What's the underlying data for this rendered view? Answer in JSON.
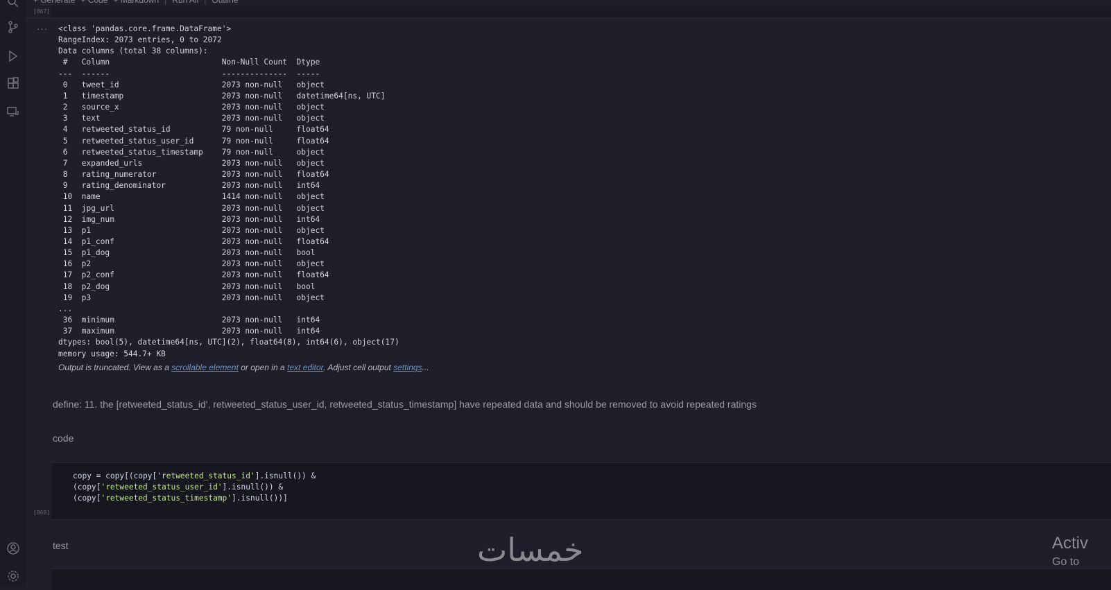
{
  "toolbar": {
    "generate": "+ Generate",
    "code": "+ Code",
    "markdown": "+ Markdown",
    "run_all": "Run All",
    "outline": "Outline"
  },
  "cells": {
    "exec_count_1": "[867]",
    "exec_count_2": "[868]"
  },
  "output": {
    "menu": "···",
    "lines": [
      "<class 'pandas.core.frame.DataFrame'>",
      "RangeIndex: 2073 entries, 0 to 2072",
      "Data columns (total 38 columns):",
      " #   Column                        Non-Null Count  Dtype",
      "---  ------                        --------------  -----",
      " 0   tweet_id                      2073 non-null   object",
      " 1   timestamp                     2073 non-null   datetime64[ns, UTC]",
      " 2   source_x                      2073 non-null   object",
      " 3   text                          2073 non-null   object",
      " 4   retweeted_status_id           79 non-null     float64",
      " 5   retweeted_status_user_id      79 non-null     float64",
      " 6   retweeted_status_timestamp    79 non-null     object",
      " 7   expanded_urls                 2073 non-null   object",
      " 8   rating_numerator              2073 non-null   float64",
      " 9   rating_denominator            2073 non-null   int64",
      " 10  name                          1414 non-null   object",
      " 11  jpg_url                       2073 non-null   object",
      " 12  img_num                       2073 non-null   int64",
      " 13  p1                            2073 non-null   object",
      " 14  p1_conf                       2073 non-null   float64",
      " 15  p1_dog                        2073 non-null   bool",
      " 16  p2                            2073 non-null   object",
      " 17  p2_conf                       2073 non-null   float64",
      " 18  p2_dog                        2073 non-null   bool",
      " 19  p3                            2073 non-null   object",
      "...",
      " 36  minimum                       2073 non-null   int64",
      " 37  maximum                       2073 non-null   int64",
      "dtypes: bool(5), datetime64[ns, UTC](2), float64(8), int64(6), object(17)",
      "memory usage: 544.7+ KB"
    ],
    "truncated": {
      "prefix": "Output is truncated. View as a ",
      "link1": "scrollable element",
      "mid1": " or open in a ",
      "link2": "text editor",
      "mid2": ". Adjust cell output ",
      "link3": "settings",
      "suffix": "..."
    }
  },
  "markdown": {
    "define": "define: 11. the [retweeted_status_id', retweeted_status_user_id, retweeted_status_timestamp] have repeated data and should be removed to avoid repeated ratings",
    "code_heading": "code",
    "test_heading": "test"
  },
  "code_cell": {
    "line1_a": "copy = copy[(copy[",
    "line1_s": "'retweeted_status_id'",
    "line1_b": "].isnull()) &",
    "line2_a": "(copy[",
    "line2_s": "'retweeted_status_user_id'",
    "line2_b": "].isnull()) &",
    "line3_a": "(copy[",
    "line3_s": "'retweeted_status_timestamp'",
    "line3_b": "].isnull())]"
  },
  "overlay": {
    "watermark": "خمسات",
    "activate_title": "Activ",
    "activate_sub": "Go to"
  },
  "icons": [
    "search-icon",
    "source-control-icon",
    "run-debug-icon",
    "extensions-icon",
    "remote-explorer-icon",
    "account-icon",
    "settings-icon"
  ]
}
